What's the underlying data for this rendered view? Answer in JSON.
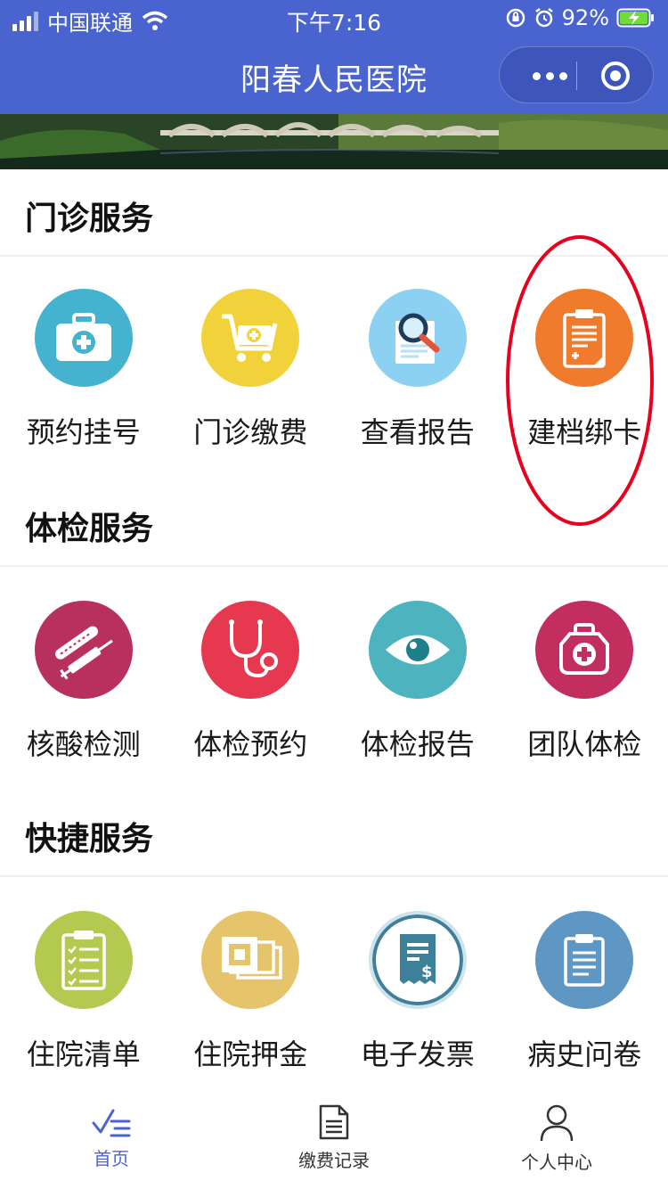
{
  "status_bar": {
    "carrier": "中国联通",
    "time": "下午7:16",
    "battery": "92%"
  },
  "nav": {
    "title": "阳春人民医院"
  },
  "sections": {
    "outpatient": {
      "title": "门诊服务",
      "items": [
        {
          "label": "预约挂号",
          "icon": "medical-kit-icon",
          "color": "#45b3cf"
        },
        {
          "label": "门诊缴费",
          "icon": "cart-icon",
          "color": "#f2d23b"
        },
        {
          "label": "查看报告",
          "icon": "report-search-icon",
          "color": "#8dd1f2"
        },
        {
          "label": "建档绑卡",
          "icon": "clipboard-icon",
          "color": "#f07b2c"
        }
      ]
    },
    "checkup": {
      "title": "体检服务",
      "items": [
        {
          "label": "核酸检测",
          "icon": "syringe-icon",
          "color": "#b8305d"
        },
        {
          "label": "体检预约",
          "icon": "stethoscope-icon",
          "color": "#e6394f"
        },
        {
          "label": "体检报告",
          "icon": "eye-icon",
          "color": "#4db3bf"
        },
        {
          "label": "团队体检",
          "icon": "first-aid-bag-icon",
          "color": "#c22e5e"
        }
      ]
    },
    "quick": {
      "title": "快捷服务",
      "items": [
        {
          "label": "住院清单",
          "icon": "checklist-icon",
          "color": "#b3c94f"
        },
        {
          "label": "住院押金",
          "icon": "cash-icon",
          "color": "#e6c46b"
        },
        {
          "label": "电子发票",
          "icon": "receipt-icon",
          "color": "#ffffff"
        },
        {
          "label": "病史问卷",
          "icon": "questionnaire-icon",
          "color": "#5e97c4"
        }
      ]
    }
  },
  "tab_bar": {
    "items": [
      {
        "label": "首页",
        "icon": "home-icon"
      },
      {
        "label": "缴费记录",
        "icon": "document-icon"
      },
      {
        "label": "个人中心",
        "icon": "user-icon"
      }
    ],
    "active_index": 0
  }
}
